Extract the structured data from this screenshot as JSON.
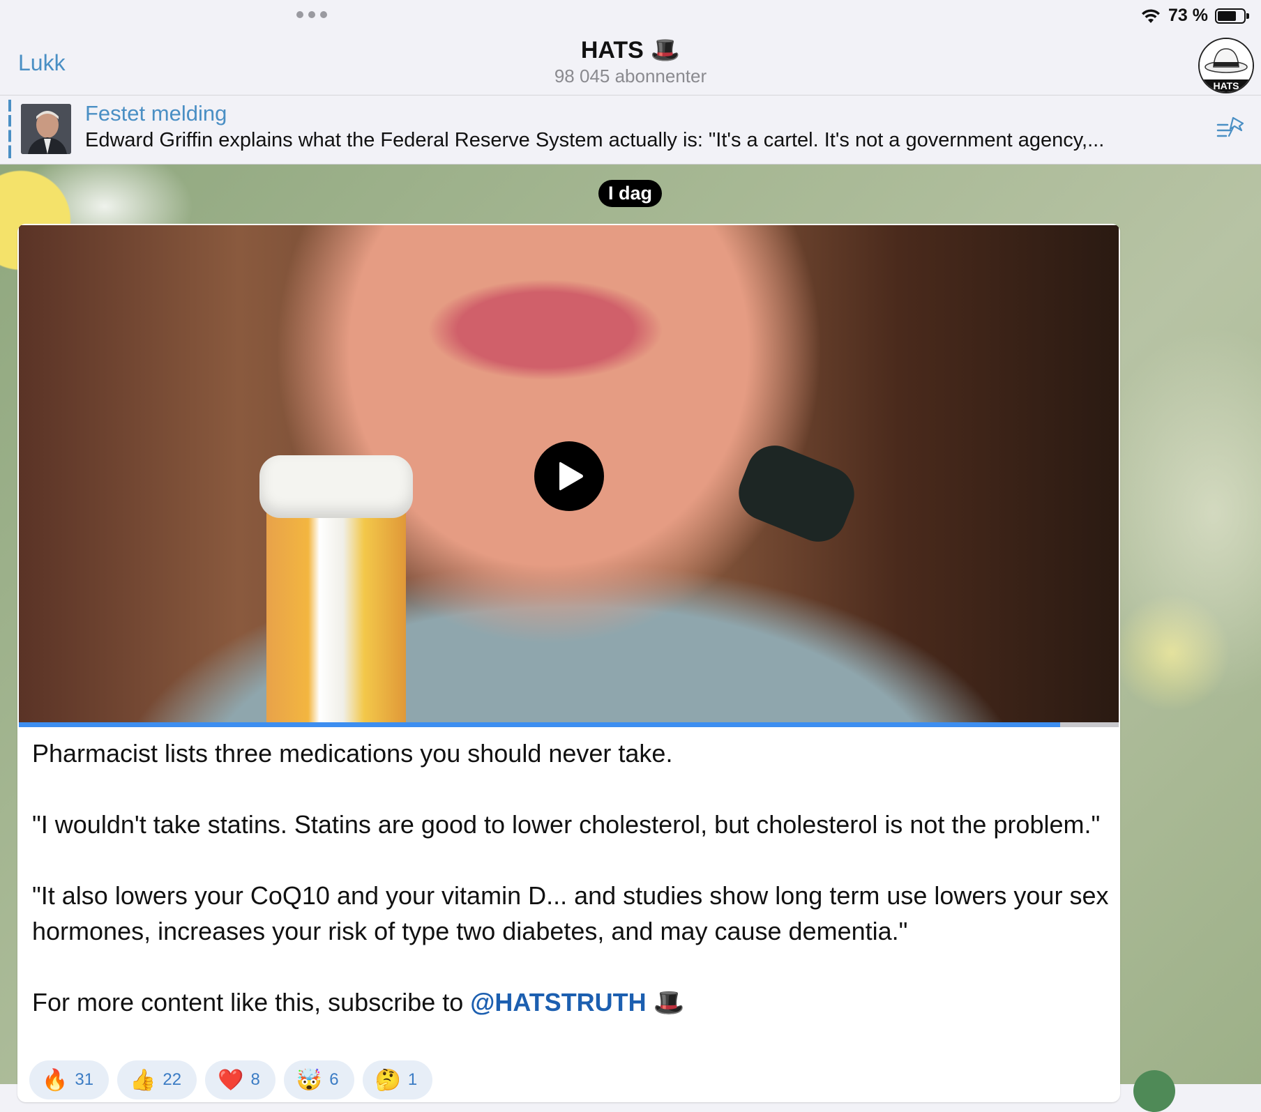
{
  "status_bar": {
    "battery_text": "73 %",
    "battery_level": 0.73
  },
  "nav": {
    "close_label": "Lukk",
    "title": "HATS",
    "title_emoji": "🎩",
    "subtitle": "98 045 abonnenter"
  },
  "pinned": {
    "title": "Festet melding",
    "text": "Edward Griffin explains what the Federal Reserve System actually is: \"It's a cartel. It's not a government agency,..."
  },
  "date_separator": "I dag",
  "video": {
    "progress": 0.947
  },
  "message": {
    "line1": "Pharmacist lists three medications you should never take.",
    "line2": "\"I wouldn't take statins. Statins are good to lower cholesterol, but cholesterol is not the problem.\"",
    "line3": "\"It also lowers your CoQ10 and your vitamin D... and studies show long term use lowers your sex hormones, increases your risk of type two diabetes, and may cause dementia.\"",
    "line4_prefix": "For more content like this, subscribe to ",
    "mention": "@HATSTRUTH",
    "line4_emoji": "🎩"
  },
  "reactions": [
    {
      "emoji": "🔥",
      "count": "31"
    },
    {
      "emoji": "👍",
      "count": "22"
    },
    {
      "emoji": "❤️",
      "count": "8"
    },
    {
      "emoji": "🤯",
      "count": "6"
    },
    {
      "emoji": "🤔",
      "count": "1"
    }
  ],
  "colors": {
    "accent": "#4a8fc4",
    "mention": "#1c5fb0",
    "progress": "#3d8ef0"
  }
}
